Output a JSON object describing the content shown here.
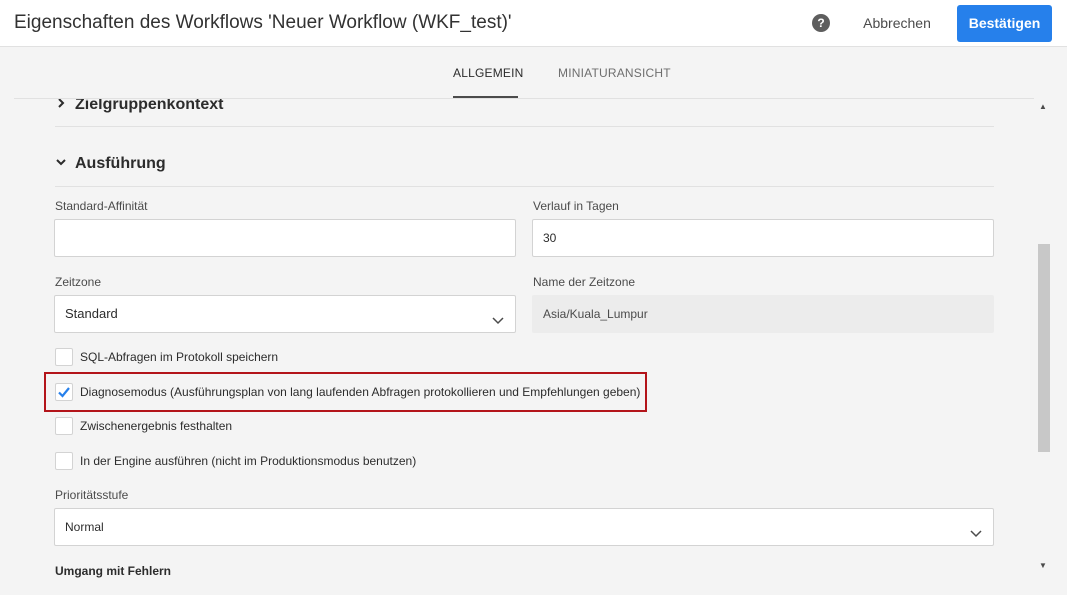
{
  "header": {
    "title": "Eigenschaften des Workflows 'Neuer Workflow (WKF_test)'",
    "help_glyph": "?",
    "cancel_label": "Abbrechen",
    "confirm_label": "Bestätigen"
  },
  "tabs": [
    {
      "label": "ALLGEMEIN",
      "active": true
    },
    {
      "label": "MINIATURANSICHT",
      "active": false
    }
  ],
  "sections": {
    "target_context": {
      "label": "Zielgruppenkontext",
      "expanded": false
    },
    "execution": {
      "label": "Ausführung",
      "expanded": true
    }
  },
  "fields": {
    "default_affinity": {
      "label": "Standard-Affinität",
      "value": ""
    },
    "history_days": {
      "label": "Verlauf in Tagen",
      "value": "30"
    },
    "timezone": {
      "label": "Zeitzone",
      "value": "Standard"
    },
    "timezone_name": {
      "label": "Name der Zeitzone",
      "value": "Asia/Kuala_Lumpur"
    },
    "priority": {
      "label": "Prioritätsstufe",
      "value": "Normal"
    }
  },
  "checkboxes": [
    {
      "label": "SQL-Abfragen im Protokoll speichern",
      "checked": false
    },
    {
      "label": "Diagnosemodus (Ausführungsplan von lang laufenden Abfragen protokollieren und Empfehlungen geben)",
      "checked": true,
      "highlighted": true
    },
    {
      "label": "Zwischenergebnis festhalten",
      "checked": false
    },
    {
      "label": "In der Engine ausführen (nicht im Produktionsmodus benutzen)",
      "checked": false
    }
  ],
  "error_handling": {
    "label": "Umgang mit Fehlern"
  },
  "colors": {
    "accent": "#2680eb",
    "highlight_border": "#b3141a",
    "check": "#2680eb"
  }
}
